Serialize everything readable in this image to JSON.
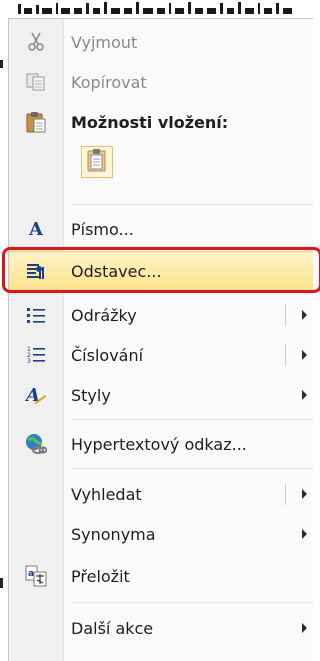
{
  "menu": {
    "items": [
      {
        "id": "cut",
        "label": "Vyjmout",
        "icon": "scissors-icon",
        "disabled": true
      },
      {
        "id": "copy",
        "label": "Kopírovat",
        "icon": "copy-icon",
        "disabled": true
      },
      {
        "id": "paste_options",
        "label": "Možnosti vložení:",
        "icon": "clipboard-icon"
      },
      {
        "id": "paste_keep_text",
        "icon": "paste-text-only-icon"
      },
      {
        "id": "font",
        "label": "Písmo...",
        "icon": "font-icon"
      },
      {
        "id": "paragraph",
        "label": "Odstavec...",
        "icon": "paragraph-icon",
        "highlighted": true
      },
      {
        "id": "bullets",
        "label": "Odrážky",
        "icon": "bullets-icon",
        "submenu": true,
        "split": true
      },
      {
        "id": "numbering",
        "label": "Číslování",
        "icon": "numbering-icon",
        "submenu": true,
        "split": true
      },
      {
        "id": "styles",
        "label": "Styly",
        "icon": "styles-icon",
        "submenu": true
      },
      {
        "id": "hyperlink",
        "label": "Hypertextový odkaz...",
        "icon": "hyperlink-icon"
      },
      {
        "id": "lookup",
        "label": "Vyhledat",
        "icon": "",
        "submenu": true,
        "split": true
      },
      {
        "id": "synonyms",
        "label": "Synonyma",
        "icon": "",
        "submenu": true
      },
      {
        "id": "translate",
        "label": "Přeložit",
        "icon": "translate-icon"
      },
      {
        "id": "more_actions",
        "label": "Další akce",
        "icon": "",
        "submenu": true
      }
    ]
  },
  "colors": {
    "highlight_top": "#fdf3c5",
    "highlight_bottom": "#fbe38c",
    "annotation_frame": "#e0141c",
    "disabled_text": "#8a8a8a"
  }
}
